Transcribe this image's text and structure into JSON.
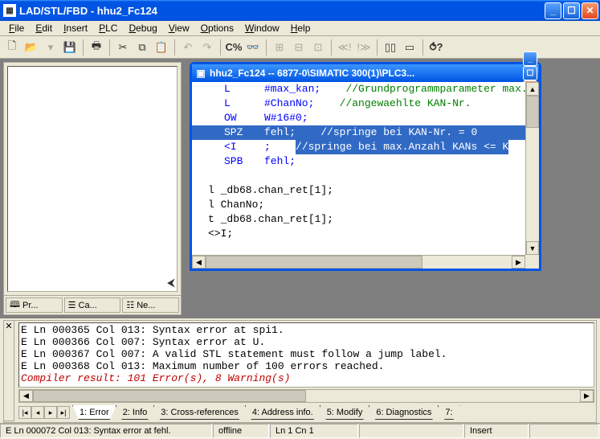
{
  "window": {
    "title": "LAD/STL/FBD  - hhu2_Fc124"
  },
  "menu": {
    "file": "File",
    "edit": "Edit",
    "insert": "Insert",
    "plc": "PLC",
    "debug": "Debug",
    "view": "View",
    "options": "Options",
    "window": "Window",
    "help": "Help"
  },
  "leftpanel": {
    "tabs": {
      "program": "Pr...",
      "call": "Ca...",
      "networks": "Ne..."
    }
  },
  "mdi": {
    "title": "hhu2_Fc124 -- 6877-0\\SIMATIC 300(1)\\PLC3...",
    "lines": [
      {
        "kw": "L",
        "op": "#max_kan;",
        "cm": "//Grundprogrammparameter max.A",
        "sel": false
      },
      {
        "kw": "L",
        "op": "#ChanNo;",
        "cm": "//angewaehlte KAN-Nr.",
        "sel": false
      },
      {
        "kw": "OW",
        "op": "W#16#0;",
        "cm": "",
        "sel": false
      },
      {
        "kw": "SPZ",
        "op": "fehl;",
        "cm": "//springe bei KAN-Nr. = 0",
        "sel": true
      },
      {
        "kw": "<I",
        "op": ";",
        "cm": "//springe bei max.Anzahl KANs <= K",
        "sel": false,
        "hlcm": true
      },
      {
        "kw": "SPB",
        "op": "fehl;",
        "cm": "",
        "sel": false
      },
      {
        "kw": "",
        "op": "",
        "cm": "",
        "sel": false,
        "plain": ""
      },
      {
        "plain": "l _db68.chan_ret[1];"
      },
      {
        "plain": "l ChanNo;"
      },
      {
        "plain": "t _db68.chan_ret[1];"
      },
      {
        "plain": "<>I;"
      }
    ]
  },
  "errors": {
    "lines": [
      "E Ln 000365 Col 013: Syntax error at spi1.",
      "E Ln 000366 Col 007: Syntax error at U.",
      "E Ln 000367 Col 007: A valid STL statement must follow a jump label.",
      "E Ln 000368 Col 013: Maximum number of 100 errors reached."
    ],
    "summary": "Compiler result: 101 Error(s), 8 Warning(s)",
    "tabs": [
      "1: Error",
      "2: Info",
      "3: Cross-references",
      "4: Address info.",
      "5: Modify",
      "6: Diagnostics",
      "7:"
    ]
  },
  "status": {
    "msg": "E Ln 000072 Col 013: Syntax error at fehl.",
    "mode": "offline",
    "pos": "Ln 1 Cn 1",
    "ins": "Insert"
  }
}
